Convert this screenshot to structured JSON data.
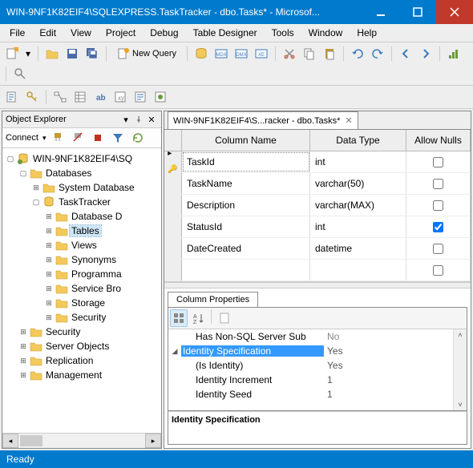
{
  "window": {
    "title": "WIN-9NF1K82EIF4\\SQLEXPRESS.TaskTracker - dbo.Tasks* - Microsof..."
  },
  "menu": [
    "File",
    "Edit",
    "View",
    "Project",
    "Debug",
    "Table Designer",
    "Tools",
    "Window",
    "Help"
  ],
  "toolbar": {
    "newquery": "New Query"
  },
  "objexp": {
    "title": "Object Explorer",
    "connect": "Connect",
    "root": "WIN-9NF1K82EIF4\\SQ",
    "nodes": {
      "databases": "Databases",
      "sysdb": "System Database",
      "tasktracker": "TaskTracker",
      "dbdiag": "Database D",
      "tables": "Tables",
      "views": "Views",
      "synonyms": "Synonyms",
      "programma": "Programma",
      "servicebro": "Service Bro",
      "storage": "Storage",
      "security_inner": "Security",
      "security": "Security",
      "serverobj": "Server Objects",
      "replication": "Replication",
      "mgmt": "Management"
    }
  },
  "tab": {
    "label": "WIN-9NF1K82EIF4\\S...racker - dbo.Tasks*"
  },
  "grid": {
    "headers": {
      "col": "Column Name",
      "type": "Data Type",
      "nulls": "Allow Nulls"
    },
    "rows": [
      {
        "name": "TaskId",
        "type": "int",
        "allownull": false,
        "key": true
      },
      {
        "name": "TaskName",
        "type": "varchar(50)",
        "allownull": false
      },
      {
        "name": "Description",
        "type": "varchar(MAX)",
        "allownull": false
      },
      {
        "name": "StatusId",
        "type": "int",
        "allownull": true
      },
      {
        "name": "DateCreated",
        "type": "datetime",
        "allownull": false
      }
    ]
  },
  "props": {
    "tab": "Column Properties",
    "rows": {
      "hasnonsql_key": "Has Non-SQL Server Sub",
      "hasnonsql_val": "No",
      "idspec_key": "Identity Specification",
      "idspec_val": "Yes",
      "isident_key": "(Is Identity)",
      "isident_val": "Yes",
      "incr_key": "Identity Increment",
      "incr_val": "1",
      "seed_key": "Identity Seed",
      "seed_val": "1"
    },
    "desc": "Identity Specification"
  },
  "status": "Ready"
}
